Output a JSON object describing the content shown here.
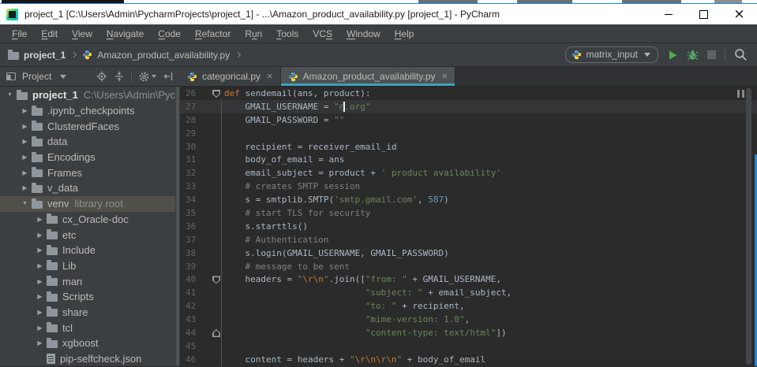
{
  "titlebar": {
    "title": "project_1 [C:\\Users\\Admin\\PycharmProjects\\project_1] - ...\\Amazon_product_availability.py [project_1] - PyCharm",
    "window_controls": [
      "minimize",
      "maximize",
      "close"
    ]
  },
  "menubar": {
    "items": [
      {
        "label": "File",
        "mnemonic": 0
      },
      {
        "label": "Edit",
        "mnemonic": 0
      },
      {
        "label": "View",
        "mnemonic": 0
      },
      {
        "label": "Navigate",
        "mnemonic": 0
      },
      {
        "label": "Code",
        "mnemonic": 0
      },
      {
        "label": "Refactor",
        "mnemonic": 0
      },
      {
        "label": "Run",
        "mnemonic": 1
      },
      {
        "label": "Tools",
        "mnemonic": 0
      },
      {
        "label": "VCS",
        "mnemonic": 2
      },
      {
        "label": "Window",
        "mnemonic": 0
      },
      {
        "label": "Help",
        "mnemonic": 0
      }
    ]
  },
  "toolbar": {
    "breadcrumbs": [
      {
        "label": "project_1",
        "icon": "folder-icon"
      },
      {
        "label": "Amazon_product_availability.py",
        "icon": "python-file-icon"
      }
    ],
    "run": {
      "config_name": "matrix_input",
      "icon": "python-file-icon",
      "buttons": [
        "run",
        "debug",
        "stop",
        "search"
      ]
    }
  },
  "project_panel": {
    "title": "Project",
    "header_icons": [
      "tool-window-icon",
      "locate-icon",
      "collapse-all-icon",
      "settings-gear-icon",
      "hide-panel-icon"
    ],
    "glyphs": {
      "down": "▼",
      "right": "▶"
    },
    "items": [
      {
        "label": "project_1",
        "extra": "C:\\Users\\Admin\\Pychar",
        "level": 0,
        "arrow": "down",
        "icon": "folder",
        "root": true
      },
      {
        "label": ".ipynb_checkpoints",
        "level": 1,
        "arrow": "right",
        "icon": "folder"
      },
      {
        "label": "ClusteredFaces",
        "level": 1,
        "arrow": "right",
        "icon": "folder"
      },
      {
        "label": "data",
        "level": 1,
        "arrow": "right",
        "icon": "folder"
      },
      {
        "label": "Encodings",
        "level": 1,
        "arrow": "right",
        "icon": "folder"
      },
      {
        "label": "Frames",
        "level": 1,
        "arrow": "right",
        "icon": "folder"
      },
      {
        "label": "v_data",
        "level": 1,
        "arrow": "right",
        "icon": "folder"
      },
      {
        "label": "venv",
        "extra": "library root",
        "level": 1,
        "arrow": "down",
        "icon": "folder",
        "selected": true
      },
      {
        "label": "cx_Oracle-doc",
        "level": 2,
        "arrow": "right",
        "icon": "folder"
      },
      {
        "label": "etc",
        "level": 2,
        "arrow": "right",
        "icon": "folder"
      },
      {
        "label": "Include",
        "level": 2,
        "arrow": "right",
        "icon": "folder"
      },
      {
        "label": "Lib",
        "level": 2,
        "arrow": "right",
        "icon": "folder"
      },
      {
        "label": "man",
        "level": 2,
        "arrow": "right",
        "icon": "folder"
      },
      {
        "label": "Scripts",
        "level": 2,
        "arrow": "right",
        "icon": "folder"
      },
      {
        "label": "share",
        "level": 2,
        "arrow": "right",
        "icon": "folder"
      },
      {
        "label": "tcl",
        "level": 2,
        "arrow": "right",
        "icon": "folder"
      },
      {
        "label": "xgboost",
        "level": 2,
        "arrow": "right",
        "icon": "folder"
      },
      {
        "label": "pip-selfcheck.json",
        "level": 2,
        "arrow": "none",
        "icon": "json"
      }
    ]
  },
  "editor_tabs": {
    "close_glyph": "×",
    "tabs": [
      {
        "label": "categorical.py",
        "active": false
      },
      {
        "label": "Amazon_product_availability.py",
        "active": true
      }
    ]
  },
  "editor": {
    "colors": {
      "k": "#CC7832",
      "d": "#A9B7C6",
      "s": "#6A8759",
      "c": "#808080",
      "n": "#6897BB",
      "e": "#CC7832",
      "line_number": "#606366",
      "current_line_bg": "#333536",
      "background": "#2B2B2B",
      "active_tab_underline": "#3DA1B8",
      "window_border": "#2186D7"
    },
    "lines": [
      {
        "n": 26,
        "fold": "down",
        "tokens": [
          [
            "k",
            "def"
          ],
          [
            "d",
            " sendemail(ans, product):"
          ]
        ]
      },
      {
        "n": 27,
        "cur": true,
        "tokens": [
          [
            "d",
            "    GMAIL_USERNAME = "
          ],
          [
            "s",
            "\"@"
          ],
          [
            "caret",
            ""
          ],
          [
            "s",
            ".org\""
          ]
        ]
      },
      {
        "n": 28,
        "tokens": [
          [
            "d",
            "    GMAIL_PASSWORD = "
          ],
          [
            "s",
            "\"\""
          ]
        ]
      },
      {
        "n": 29,
        "tokens": []
      },
      {
        "n": 30,
        "tokens": [
          [
            "d",
            "    recipient = receiver_email_id"
          ]
        ]
      },
      {
        "n": 31,
        "tokens": [
          [
            "d",
            "    body_of_email = ans"
          ]
        ]
      },
      {
        "n": 32,
        "tokens": [
          [
            "d",
            "    email_subject = product + "
          ],
          [
            "s",
            "' product availability'"
          ]
        ]
      },
      {
        "n": 33,
        "tokens": [
          [
            "c",
            "    # creates SMTP session"
          ]
        ]
      },
      {
        "n": 34,
        "tokens": [
          [
            "d",
            "    s = smtplib.SMTP("
          ],
          [
            "s",
            "'smtp.gmail.com'"
          ],
          [
            "d",
            ", "
          ],
          [
            "n2",
            "587"
          ],
          [
            "d",
            ")"
          ]
        ]
      },
      {
        "n": 35,
        "tokens": [
          [
            "c",
            "    # start TLS for security"
          ]
        ]
      },
      {
        "n": 36,
        "tokens": [
          [
            "d",
            "    s.starttls()"
          ]
        ]
      },
      {
        "n": 37,
        "tokens": [
          [
            "c",
            "    # Authentication"
          ]
        ]
      },
      {
        "n": 38,
        "tokens": [
          [
            "d",
            "    s.login(GMAIL_USERNAME, GMAIL_PASSWORD)"
          ]
        ]
      },
      {
        "n": 39,
        "tokens": [
          [
            "c",
            "    # message to be sent"
          ]
        ]
      },
      {
        "n": 40,
        "fold": "down",
        "tokens": [
          [
            "d",
            "    headers = "
          ],
          [
            "s",
            "\""
          ],
          [
            "e",
            "\\r\\n"
          ],
          [
            "s",
            "\""
          ],
          [
            "d",
            ".join(["
          ],
          [
            "s",
            "\"from: \""
          ],
          [
            "d",
            " + GMAIL_USERNAME,"
          ]
        ]
      },
      {
        "n": 41,
        "tokens": [
          [
            "d",
            "                           "
          ],
          [
            "s",
            "\"subject: \""
          ],
          [
            "d",
            " + email_subject,"
          ]
        ]
      },
      {
        "n": 42,
        "tokens": [
          [
            "d",
            "                           "
          ],
          [
            "s",
            "\"to: \""
          ],
          [
            "d",
            " + recipient,"
          ]
        ]
      },
      {
        "n": 43,
        "tokens": [
          [
            "d",
            "                           "
          ],
          [
            "s",
            "\"mime-version: 1.0\""
          ],
          [
            "d",
            ","
          ]
        ]
      },
      {
        "n": 44,
        "fold": "up",
        "tokens": [
          [
            "d",
            "                           "
          ],
          [
            "s",
            "\"content-type: text/html\""
          ],
          [
            "d",
            "])"
          ]
        ]
      },
      {
        "n": 45,
        "tokens": []
      },
      {
        "n": 46,
        "tokens": [
          [
            "d",
            "    content = headers + "
          ],
          [
            "s",
            "\""
          ],
          [
            "e",
            "\\r\\n\\r\\n"
          ],
          [
            "s",
            "\""
          ],
          [
            "d",
            " + body_of_email"
          ]
        ]
      }
    ]
  }
}
